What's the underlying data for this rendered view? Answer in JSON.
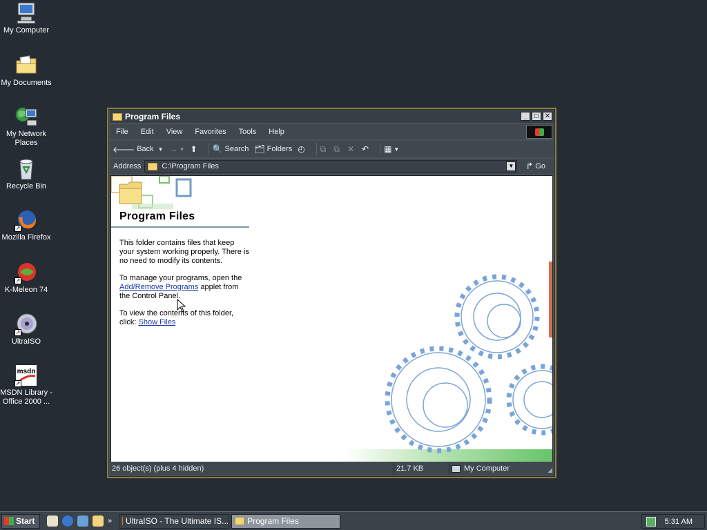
{
  "desktop": {
    "icons": [
      {
        "label": "My Computer"
      },
      {
        "label": "My Documents"
      },
      {
        "label": "My Network Places"
      },
      {
        "label": "Recycle Bin"
      },
      {
        "label": "Mozilla Firefox"
      },
      {
        "label": "K-Meleon 74"
      },
      {
        "label": "UltraISO"
      },
      {
        "label": "MSDN Library - Office 2000 ..."
      }
    ]
  },
  "window": {
    "title": "Program Files",
    "menu": [
      "File",
      "Edit",
      "View",
      "Favorites",
      "Tools",
      "Help"
    ],
    "toolbar": {
      "back": "Back",
      "search": "Search",
      "folders": "Folders"
    },
    "address": {
      "label": "Address",
      "value": "C:\\Program Files",
      "go": "Go"
    },
    "pane": {
      "heading": "Program Files",
      "para1": "This folder contains files that keep your system working properly. There is no need to modify its contents.",
      "para2_pre": "To manage your programs, open the",
      "para2_link": "Add/Remove Programs",
      "para2_post": "applet from the Control Panel.",
      "para3_pre": "To view the contents of this folder, click:",
      "para3_link": "Show Files"
    },
    "status": {
      "objects": "26 object(s) (plus 4 hidden)",
      "size": "21.7 KB",
      "zone": "My Computer"
    }
  },
  "taskbar": {
    "start": "Start",
    "tasks": [
      {
        "label": "UltraISO - The Ultimate IS..."
      },
      {
        "label": "Program Files"
      }
    ],
    "clock": "5:31 AM"
  },
  "colors": {
    "desktop": "#262c33",
    "window_frame": "#8a7f42",
    "link": "#1a38a6"
  }
}
